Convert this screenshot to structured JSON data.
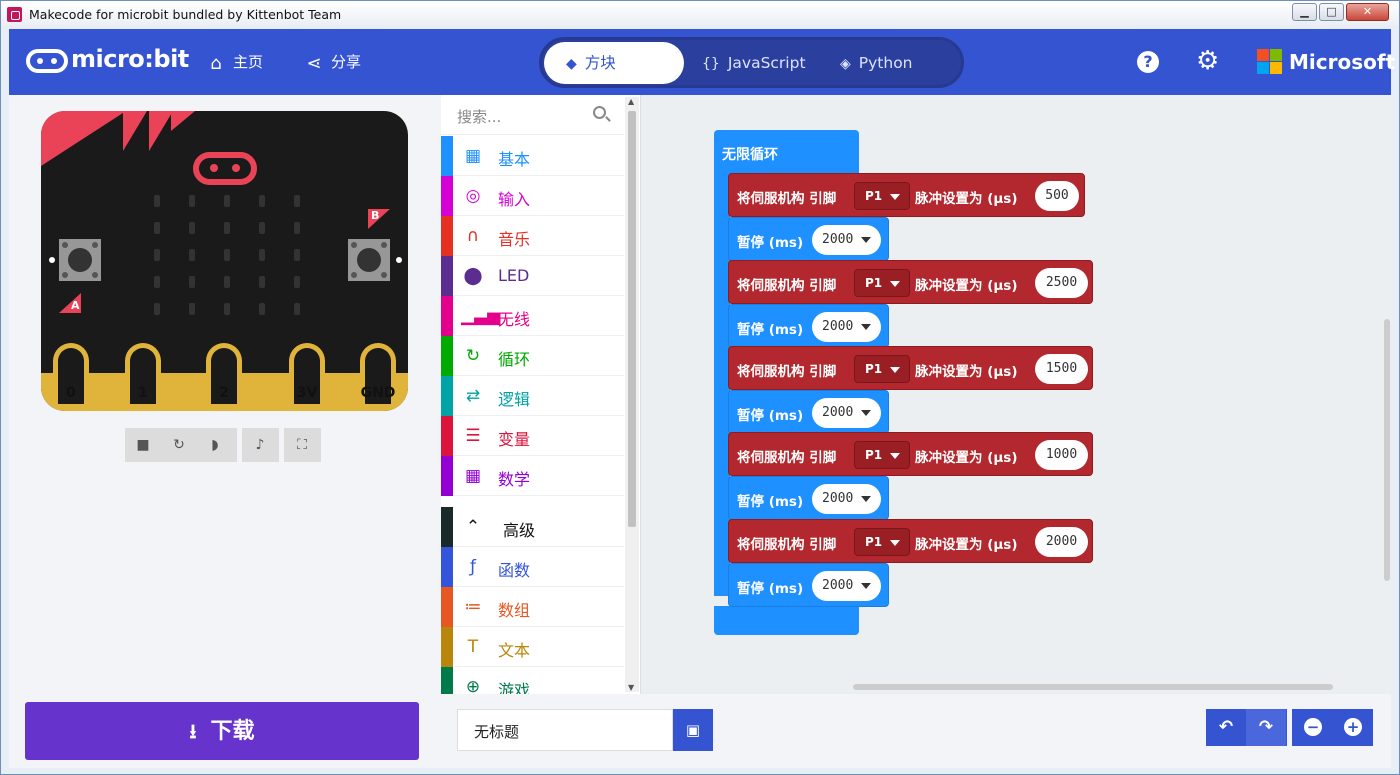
{
  "window": {
    "title": "Makecode for microbit bundled by Kittenbot Team",
    "controls": {
      "minimize": "▁",
      "maximize": "□",
      "close": "✕"
    }
  },
  "menubar": {
    "brand": "micro:bit",
    "home_label": "主页",
    "share_label": "分享",
    "tabs": [
      {
        "label": "方块",
        "icon": "puzzle-icon",
        "active": true
      },
      {
        "label": "JavaScript",
        "icon": "braces-icon",
        "active": false
      },
      {
        "label": "Python",
        "icon": "python-icon",
        "active": false
      }
    ],
    "help_glyph": "?",
    "microsoft_label": "Microsoft"
  },
  "simulator": {
    "button_a": "A",
    "button_b": "B",
    "pins": [
      "0",
      "1",
      "2",
      "3V",
      "GND"
    ],
    "controls": [
      "stop-icon",
      "restart-icon",
      "slow-mo-icon",
      "mute-icon",
      "fullscreen-icon"
    ]
  },
  "download": {
    "label": "下载"
  },
  "toolbox": {
    "search_placeholder": "搜索...",
    "categories": [
      {
        "label": "基本",
        "color": "#1e90ff",
        "icon": "grid-icon"
      },
      {
        "label": "输入",
        "color": "#d400d4",
        "icon": "target-icon"
      },
      {
        "label": "音乐",
        "color": "#e63022",
        "icon": "headphones-icon"
      },
      {
        "label": "LED",
        "color": "#5c2d91",
        "icon": "toggle-icon"
      },
      {
        "label": "无线",
        "color": "#e3008c",
        "icon": "signal-bars-icon"
      },
      {
        "label": "循环",
        "color": "#00aa00",
        "icon": "refresh-icon"
      },
      {
        "label": "逻辑",
        "color": "#00a4a6",
        "icon": "shuffle-icon"
      },
      {
        "label": "变量",
        "color": "#dc143c",
        "icon": "lines-icon"
      },
      {
        "label": "数学",
        "color": "#9400d3",
        "icon": "calculator-icon"
      }
    ],
    "advanced_label": "高级",
    "advanced_categories": [
      {
        "label": "函数",
        "color": "#3455db",
        "icon": "function-icon"
      },
      {
        "label": "数组",
        "color": "#e65722",
        "icon": "list-icon"
      },
      {
        "label": "文本",
        "color": "#b8860b",
        "icon": "text-icon"
      },
      {
        "label": "游戏",
        "color": "#007a4b",
        "icon": "gamepad-icon"
      }
    ]
  },
  "workspace": {
    "loop_label": "无限循环",
    "servo_blocks": [
      {
        "prefix": "将伺服机构 引脚",
        "pin": "P1",
        "suffix": "脉冲设置为 (μs)",
        "value": "500",
        "pause_label": "暂停 (ms)",
        "pause": "2000"
      },
      {
        "prefix": "将伺服机构 引脚",
        "pin": "P1",
        "suffix": "脉冲设置为 (μs)",
        "value": "2500",
        "pause_label": "暂停 (ms)",
        "pause": "2000"
      },
      {
        "prefix": "将伺服机构 引脚",
        "pin": "P1",
        "suffix": "脉冲设置为 (μs)",
        "value": "1500",
        "pause_label": "暂停 (ms)",
        "pause": "2000"
      },
      {
        "prefix": "将伺服机构 引脚",
        "pin": "P1",
        "suffix": "脉冲设置为 (μs)",
        "value": "1000",
        "pause_label": "暂停 (ms)",
        "pause": "2000"
      },
      {
        "prefix": "将伺服机构 引脚",
        "pin": "P1",
        "suffix": "脉冲设置为 (μs)",
        "value": "2000",
        "pause_label": "暂停 (ms)",
        "pause": "2000"
      }
    ]
  },
  "footer": {
    "project_name": "无标题",
    "undo_glyph": "↶",
    "redo_glyph": "↷",
    "zoom_out_glyph": "−",
    "zoom_in_glyph": "+"
  },
  "colors": {
    "accent": "#3454d1",
    "download": "#6633cc",
    "servo": "#b2282e",
    "loop": "#1e90ff"
  }
}
